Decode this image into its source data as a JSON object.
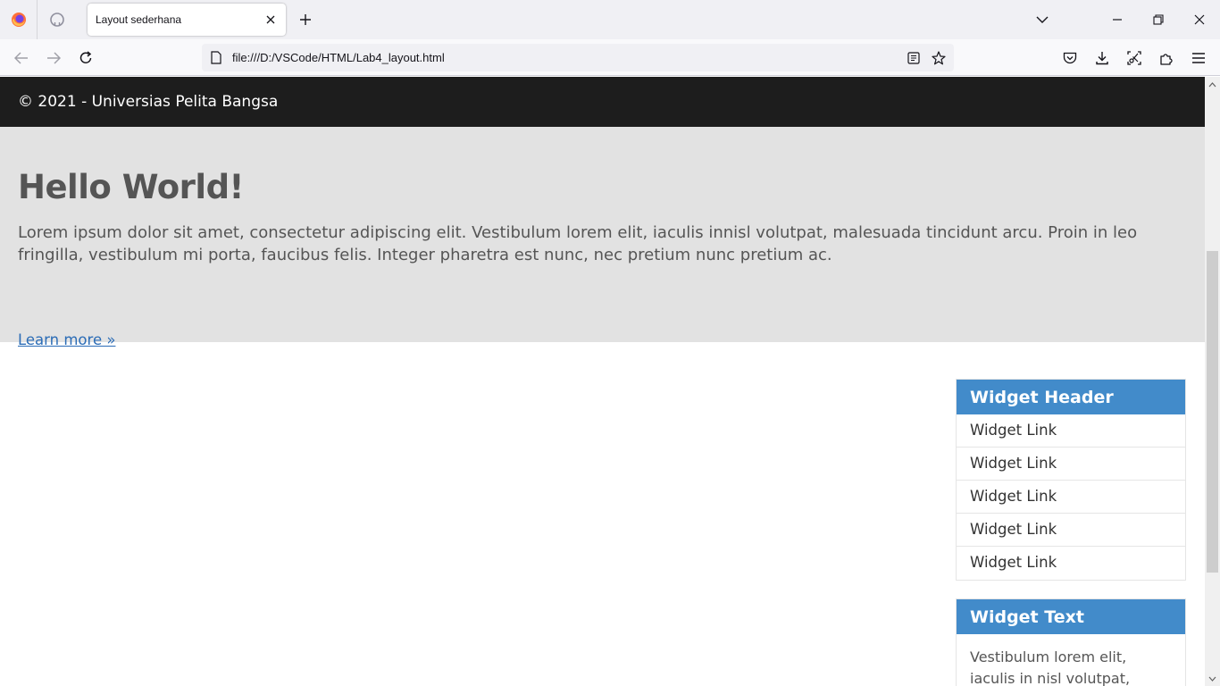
{
  "browser": {
    "tab": {
      "title": "Layout sederhana"
    },
    "address_bar": {
      "url": "file:///D:/VSCode/HTML/Lab4_layout.html"
    }
  },
  "page": {
    "footer": {
      "text": "© 2021 - Universias Pelita Bangsa"
    },
    "hero": {
      "title": "Hello World!",
      "text": "Lorem ipsum dolor sit amet, consectetur adipiscing elit. Vestibulum lorem elit, iaculis innisl volutpat, malesuada tincidunt arcu. Proin in leo fringilla, vestibulum mi porta, faucibus felis. Integer pharetra est nunc, nec pretium nunc pretium ac.",
      "link_label": "Learn more »"
    },
    "widget_links": {
      "header": "Widget Header",
      "links": [
        "Widget Link",
        "Widget Link",
        "Widget Link",
        "Widget Link",
        "Widget Link"
      ]
    },
    "widget_text": {
      "header": "Widget Text",
      "body": "Vestibulum lorem elit, iaculis in nisl volutpat, malesuada"
    }
  }
}
